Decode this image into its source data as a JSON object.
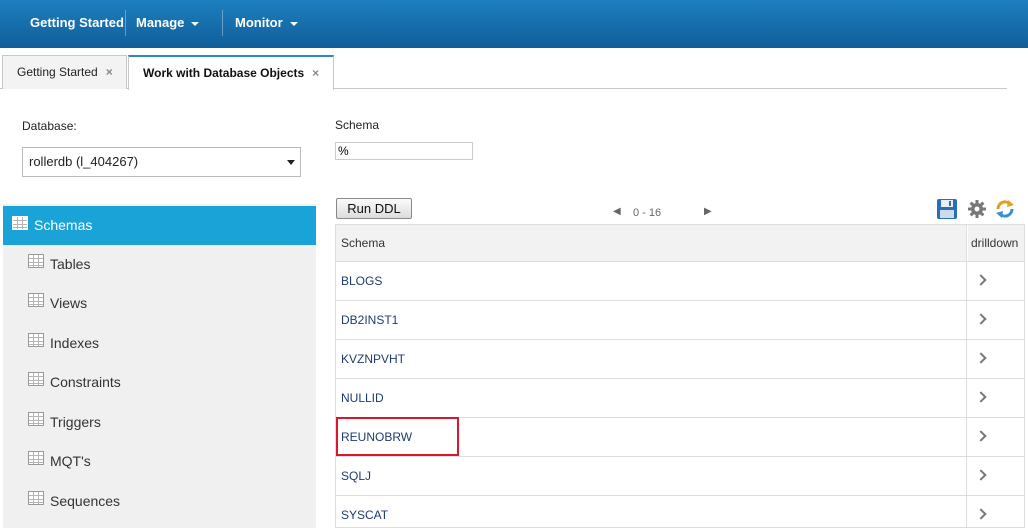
{
  "topnav": {
    "items": [
      {
        "label": "Getting Started",
        "dropdown": false
      },
      {
        "label": "Manage",
        "dropdown": true
      },
      {
        "label": "Monitor",
        "dropdown": true
      }
    ]
  },
  "tabs": [
    {
      "label": "Getting Started",
      "active": false,
      "close": "×"
    },
    {
      "label": "Work with Database Objects",
      "active": true,
      "close": "×"
    }
  ],
  "form": {
    "database_label": "Database:",
    "database_value": "rollerdb (l_404267)",
    "schema_label": "Schema",
    "schema_value": "%"
  },
  "sidebar": {
    "items": [
      {
        "label": "Schemas",
        "active": true
      },
      {
        "label": "Tables",
        "active": false
      },
      {
        "label": "Views",
        "active": false
      },
      {
        "label": "Indexes",
        "active": false
      },
      {
        "label": "Constraints",
        "active": false
      },
      {
        "label": "Triggers",
        "active": false
      },
      {
        "label": "MQT's",
        "active": false
      },
      {
        "label": "Sequences",
        "active": false
      }
    ]
  },
  "toolbar": {
    "run_ddl_label": "Run DDL",
    "pager_text": "0 - 16",
    "icons": [
      "save-icon",
      "gear-icon",
      "refresh-icon"
    ]
  },
  "table": {
    "columns": [
      "Schema",
      "drilldown"
    ],
    "rows": [
      "BLOGS",
      "DB2INST1",
      "KVZNPVHT",
      "NULLID",
      "REUNOBRW",
      "SQLJ",
      "SYSCAT"
    ],
    "highlighted_row": "REUNOBRW"
  },
  "colors": {
    "topbar": "#1577b6",
    "sidebar_active": "#1aa3d6",
    "highlight_border": "#d9182d"
  }
}
